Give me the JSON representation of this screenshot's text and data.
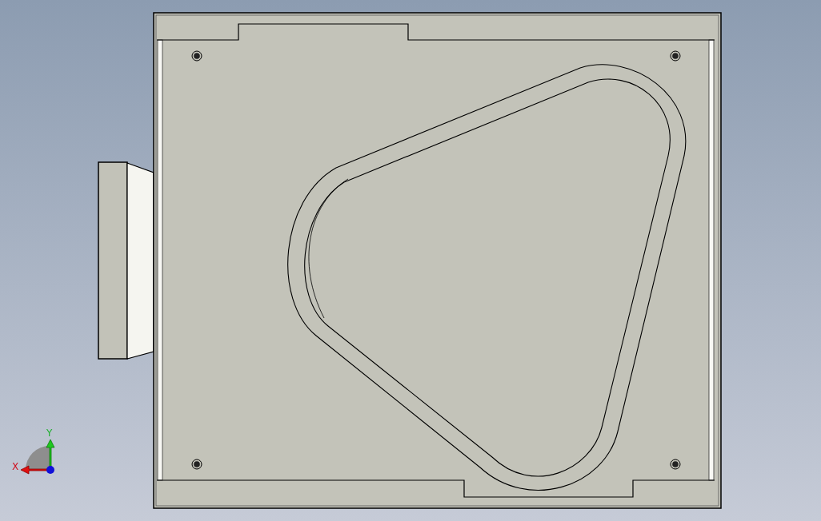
{
  "viewport": {
    "axis_triad": {
      "x_label": "X",
      "y_label": "Y"
    }
  }
}
